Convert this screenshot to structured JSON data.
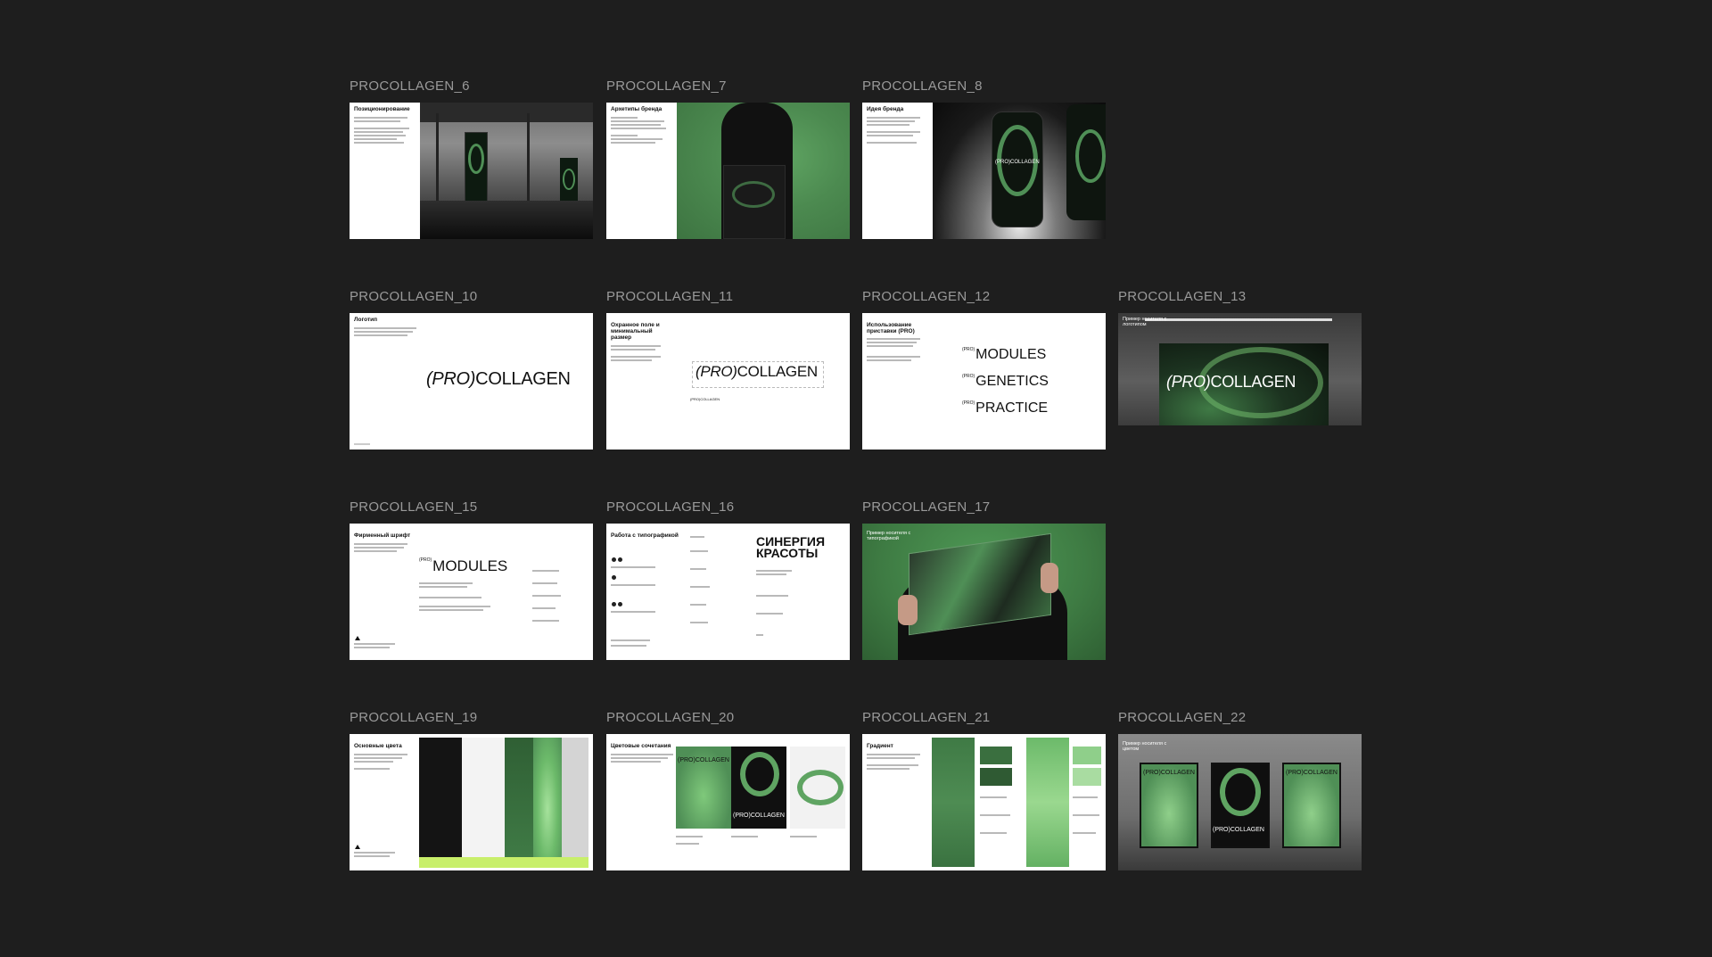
{
  "frames": [
    {
      "label": "PROCOLLAGEN_6",
      "title": "Позиционирование"
    },
    {
      "label": "PROCOLLAGEN_7",
      "title": "Архетипы бренда"
    },
    {
      "label": "PROCOLLAGEN_8",
      "title": "Идея бренда",
      "brand": "(PRO)COLLAGEN"
    },
    {
      "label": "PROCOLLAGEN_10",
      "title": "Логотип",
      "brand_pro": "(PRO)",
      "brand_rest": "COLLAGEN"
    },
    {
      "label": "PROCOLLAGEN_11",
      "title": "Охранное поле и минимальный размер",
      "brand_pro": "(PRO)",
      "brand_rest": "COLLAGEN",
      "brand_small": "(PRO)COLLAGEN"
    },
    {
      "label": "PROCOLLAGEN_12",
      "title": "Использование приставки (PRO)",
      "pro": "(PRO)",
      "words": [
        "MODULES",
        "GENETICS",
        "PRACTICE"
      ]
    },
    {
      "label": "PROCOLLAGEN_13",
      "title": "Пример носителя с логотипом",
      "brand_pro": "(PRO)",
      "brand_rest": "COLLAGEN"
    },
    {
      "label": "PROCOLLAGEN_15",
      "title": "Фирменный шрифт",
      "pro": "(PRO)",
      "word": "MODULES"
    },
    {
      "label": "PROCOLLAGEN_16",
      "title": "Работа с типографикой",
      "headline_1": "СИНЕРГИЯ",
      "headline_2": "КРАСОТЫ"
    },
    {
      "label": "PROCOLLAGEN_17",
      "title": "Пример носителя с типографикой"
    },
    {
      "label": "PROCOLLAGEN_19",
      "title": "Основные цвета"
    },
    {
      "label": "PROCOLLAGEN_20",
      "title": "Цветовые сочетания",
      "brand": "(PRO)COLLAGEN"
    },
    {
      "label": "PROCOLLAGEN_21",
      "title": "Градиент"
    },
    {
      "label": "PROCOLLAGEN_22",
      "title": "Пример носителя с цветом",
      "brand": "(PRO)COLLAGEN"
    }
  ],
  "colors": {
    "background": "#1e1e1e",
    "label": "#9a9a9a",
    "dark_green": "#1f3a24",
    "brand_green": "#4f8f56",
    "light_green": "#8fcf8a",
    "lime": "#c8ef6a",
    "black": "#141414"
  }
}
